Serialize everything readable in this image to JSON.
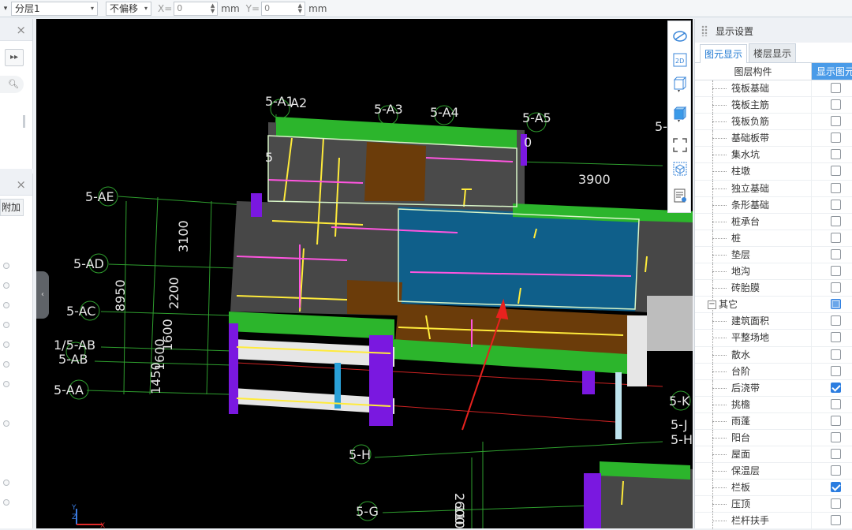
{
  "toolbar": {
    "layer_select": "分层1",
    "offset_select": "不偏移",
    "x_label": "X=",
    "x_value": "0",
    "y_label": "Y=",
    "y_value": "0",
    "unit": "mm"
  },
  "left_panel": {
    "add_button": "附加"
  },
  "right_panel": {
    "title": "显示设置",
    "tabs": [
      "图元显示",
      "楼层显示"
    ],
    "col_component": "图层构件",
    "col_show": "显示图元",
    "rows": [
      {
        "name": "筏板基础",
        "checked": false,
        "group": false
      },
      {
        "name": "筏板主筋",
        "checked": false,
        "group": false
      },
      {
        "name": "筏板负筋",
        "checked": false,
        "group": false
      },
      {
        "name": "基础板带",
        "checked": false,
        "group": false
      },
      {
        "name": "集水坑",
        "checked": false,
        "group": false
      },
      {
        "name": "柱墩",
        "checked": false,
        "group": false
      },
      {
        "name": "独立基础",
        "checked": false,
        "group": false
      },
      {
        "name": "条形基础",
        "checked": false,
        "group": false
      },
      {
        "name": "桩承台",
        "checked": false,
        "group": false
      },
      {
        "name": "桩",
        "checked": false,
        "group": false
      },
      {
        "name": "垫层",
        "checked": false,
        "group": false
      },
      {
        "name": "地沟",
        "checked": false,
        "group": false
      },
      {
        "name": "砖胎膜",
        "checked": false,
        "group": false
      },
      {
        "name": "其它",
        "checked": "partial",
        "group": true
      },
      {
        "name": "建筑面积",
        "checked": false,
        "group": false
      },
      {
        "name": "平整场地",
        "checked": false,
        "group": false
      },
      {
        "name": "散水",
        "checked": false,
        "group": false
      },
      {
        "name": "台阶",
        "checked": false,
        "group": false
      },
      {
        "name": "后浇带",
        "checked": true,
        "group": false
      },
      {
        "name": "挑檐",
        "checked": false,
        "group": false
      },
      {
        "name": "雨蓬",
        "checked": false,
        "group": false
      },
      {
        "name": "阳台",
        "checked": false,
        "group": false
      },
      {
        "name": "屋面",
        "checked": false,
        "group": false
      },
      {
        "name": "保温层",
        "checked": false,
        "group": false
      },
      {
        "name": "栏板",
        "checked": true,
        "group": false
      },
      {
        "name": "压顶",
        "checked": false,
        "group": false
      },
      {
        "name": "栏杆扶手",
        "checked": false,
        "group": false
      }
    ]
  },
  "viewport": {
    "axis_labels": [
      "5-A1",
      "A2",
      "5-A3",
      "5-A4",
      "5-A5",
      "5-",
      "5-AE",
      "5-AD",
      "5-AC",
      "1/5-AB",
      "5-AB",
      "5-AA",
      "5-H",
      "5-G",
      "5-K",
      "5-J",
      "5-H"
    ],
    "dimensions": [
      "3900",
      "3100",
      "2200",
      "1600",
      "1600",
      "8950",
      "1450",
      "2600",
      "1100",
      "5",
      "0"
    ],
    "axis_triad": [
      "Y",
      "Z",
      "X"
    ]
  }
}
